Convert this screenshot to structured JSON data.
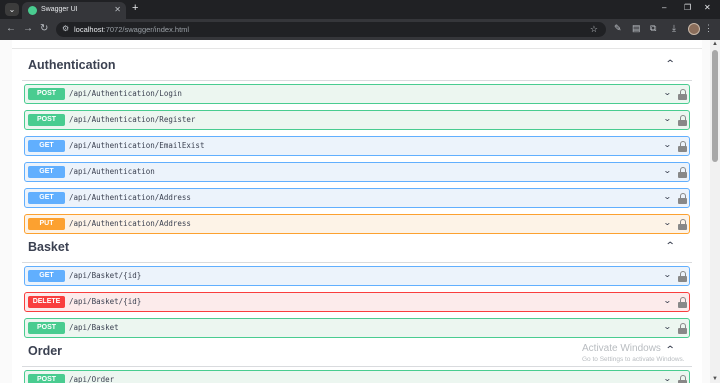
{
  "browser": {
    "tab_title": "Swagger UI",
    "url_host": "localhost",
    "url_path": ":7072/swagger/index.html"
  },
  "sections": [
    {
      "title": "Authentication",
      "ops": [
        {
          "method": "POST",
          "path": "/api/Authentication/Login"
        },
        {
          "method": "POST",
          "path": "/api/Authentication/Register"
        },
        {
          "method": "GET",
          "path": "/api/Authentication/EmailExist"
        },
        {
          "method": "GET",
          "path": "/api/Authentication"
        },
        {
          "method": "GET",
          "path": "/api/Authentication/Address"
        },
        {
          "method": "PUT",
          "path": "/api/Authentication/Address"
        }
      ]
    },
    {
      "title": "Basket",
      "ops": [
        {
          "method": "GET",
          "path": "/api/Basket/{id}"
        },
        {
          "method": "DELETE",
          "path": "/api/Basket/{id}"
        },
        {
          "method": "POST",
          "path": "/api/Basket"
        }
      ]
    },
    {
      "title": "Order",
      "ops": [
        {
          "method": "POST",
          "path": "/api/Order"
        }
      ]
    }
  ],
  "watermark": {
    "title": "Activate Windows",
    "subtitle": "Go to Settings to activate Windows."
  }
}
